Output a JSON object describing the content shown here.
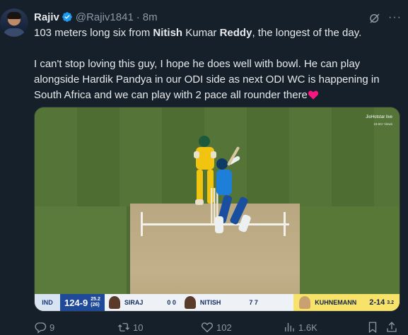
{
  "tweet": {
    "author_name": "Rajiv",
    "handle": "@Rajiv1841",
    "separator": "·",
    "time": "8m",
    "more_label": "···",
    "line1_pre": "103 meters long six from ",
    "line1_bold1": "Nitish",
    "line1_mid": " Kumar ",
    "line1_bold2": "Reddy",
    "line1_post": ", the longest of the day.",
    "line2": "I can't stop loving this guy, I hope he does well with bowl. He can play alongside Hardik Pandya in our ODI side as next ODI WC is happening in South Africa and we can play with 2 pace all rounder there"
  },
  "media": {
    "broadcaster": "JioHotstar",
    "live_badge": "live",
    "views": "19.6Cr Views",
    "score": "124-9",
    "overs": "25.2",
    "overs_total": "(26)",
    "team_badge": "IND",
    "bowler_left": "SIRAJ",
    "bowler_left_stats": "0 0",
    "batter": "NITISH",
    "batter_stats": "7 7",
    "bowler": "KUHNEMANN",
    "bowler_figures": "2-14",
    "bowler_overs": "3.2"
  },
  "actions": {
    "replies": "9",
    "reposts": "10",
    "likes": "102",
    "views": "1.6K"
  },
  "colors": {
    "background": "#15202b",
    "text": "#e7e9ea",
    "muted": "#8b98a5",
    "verified": "#1d9bf0",
    "heart": "#f91880"
  },
  "icons": [
    "verified-badge-icon",
    "grok-icon",
    "more-icon",
    "reply-icon",
    "repost-icon",
    "like-icon",
    "views-icon",
    "bookmark-icon",
    "share-icon",
    "heart-emoji"
  ]
}
